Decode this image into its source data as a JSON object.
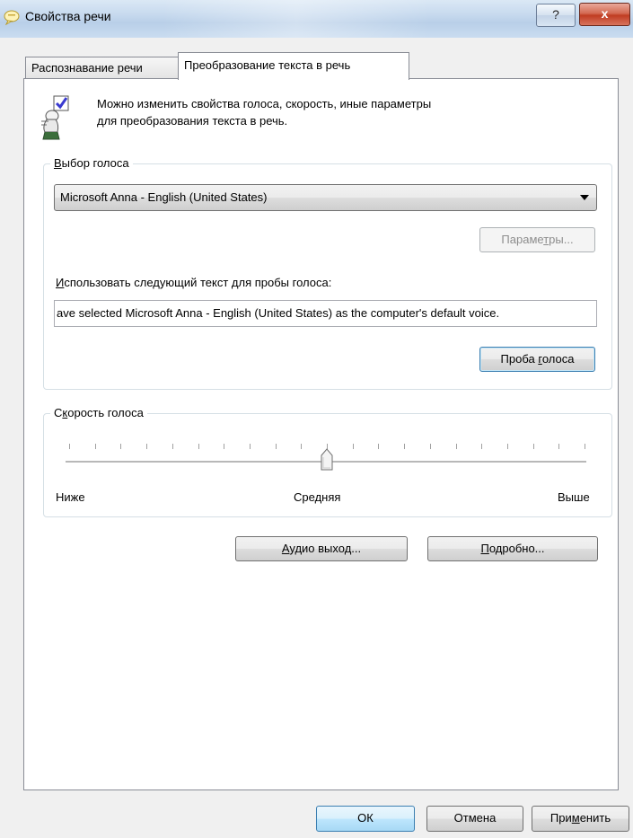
{
  "window": {
    "title": "Свойства речи",
    "help_label": "?",
    "close_label": "x"
  },
  "tabs": [
    {
      "label": "Распознавание речи",
      "selected": false
    },
    {
      "label": "Преобразование текста в речь",
      "selected": true
    }
  ],
  "intro": {
    "line1": "Можно изменить свойства голоса, скорость, иные параметры",
    "line2": "для преобразования текста в речь."
  },
  "voice_group": {
    "title_hotkey": "В",
    "title_rest": "ыбор голоса",
    "selected_voice": "Microsoft Anna - English (United States)",
    "settings_button": {
      "pre": "Параме",
      "hotkey": "т",
      "post": "ры..."
    },
    "preview_label_hotkey": "И",
    "preview_label_rest": "спользовать следующий текст для пробы голоса:",
    "preview_text": "ave selected Microsoft Anna - English (United States) as the computer's default voice.",
    "preview_button": {
      "pre": "Проба ",
      "hotkey": "г",
      "post": "олоса"
    }
  },
  "rate_group": {
    "title_pre": "С",
    "title_hotkey": "к",
    "title_post": "орость голоса",
    "low_label": "Ниже",
    "mid_label": "Средняя",
    "high_label": "Выше",
    "slider_position": 0.5,
    "tick_count": 21
  },
  "buttons": {
    "audio_output": {
      "hotkey": "А",
      "rest": "удио выход..."
    },
    "advanced": {
      "hotkey": "П",
      "rest": "одробно..."
    }
  },
  "dialog": {
    "ok": "ОК",
    "cancel": "Отмена",
    "apply": {
      "pre": "При",
      "hotkey": "м",
      "post": "енить"
    }
  },
  "colors": {
    "accent": "#3c7fb1",
    "close": "#c03c22",
    "panel_bg": "#ffffff",
    "window_bg": "#f0f0f0"
  }
}
